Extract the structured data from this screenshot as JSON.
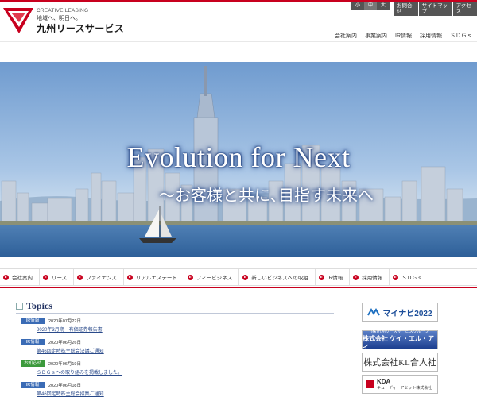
{
  "header": {
    "logo_tagline_en": "CREATIVE LEASING",
    "logo_tagline_jp": "地域へ、明日へ。",
    "logo_name": "九州リースサービス",
    "font_size_controls": [
      "小",
      "中",
      "大"
    ],
    "utility_links": [
      "お問合せ",
      "サイトマップ",
      "アクセス"
    ],
    "global_nav": [
      "会社案内",
      "事業案内",
      "IR情報",
      "採用情報",
      "ＳＤＧｓ"
    ]
  },
  "hero": {
    "title": "Evolution for Next",
    "subtitle": "～お客様と共に､目指す未来へ"
  },
  "subnav": [
    "会社案内",
    "リース",
    "ファイナンス",
    "リアルエステート",
    "フィービジネス",
    "新しいビジネスへの取組",
    "IR情報",
    "採用情報",
    "ＳＤＧｓ"
  ],
  "topics": {
    "title": "Topics",
    "items": [
      {
        "badge": "IR情報",
        "badge_color": "#3a6bb5",
        "date": "2020年07月22日",
        "text": "2020年3月期　有価証券報告書"
      },
      {
        "badge": "IR情報",
        "badge_color": "#3a6bb5",
        "date": "2020年06月26日",
        "text": "第46回定時株主総会決議ご通知"
      },
      {
        "badge": "お知らせ",
        "badge_color": "#3c9a3c",
        "date": "2020年06月19日",
        "text": "ＳＤＧｓへの取り組みを掲載しました。"
      },
      {
        "badge": "IR情報",
        "badge_color": "#3a6bb5",
        "date": "2020年06月08日",
        "text": "第46回定時株主総会招集ご通知"
      }
    ]
  },
  "banners": {
    "mynavi": "マイナビ2022",
    "qli_group": "(株)九州リースサービスグループ",
    "qli_name": "株式会社 ケイ・エル・アイ",
    "kl": "株式会社KL合人社",
    "kda": "KDA",
    "kda_sub": "キューディーアセット株式会社"
  },
  "colors": {
    "brand_red": "#c8001e",
    "navy": "#203060",
    "link": "#2a4a8a"
  }
}
